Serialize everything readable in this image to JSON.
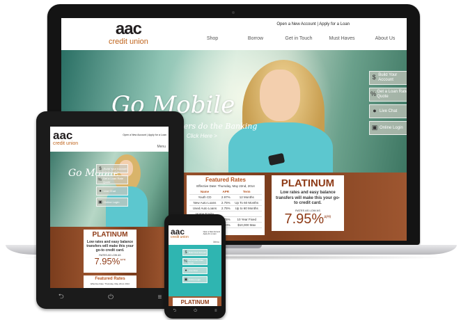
{
  "brand": {
    "name": "aac",
    "tagline": "credit union"
  },
  "top_links": {
    "open_account": "Open a New Account",
    "separator": "|",
    "apply_loan": "Apply for a Loan"
  },
  "nav": [
    "Shop",
    "Borrow",
    "Get in Touch",
    "Must Haves",
    "About Us"
  ],
  "menu_label": "Menu",
  "hero": {
    "title": "Go Mobile",
    "subtitle": "Let Your Fingers do the Banking",
    "cta": "Click Here >"
  },
  "side_buttons": [
    {
      "label": "Build Your Account",
      "icon": "dollar-icon"
    },
    {
      "label": "Get a Loan Rate Quote",
      "icon": "percent-icon"
    },
    {
      "label": "Live Chat",
      "icon": "chat-icon"
    },
    {
      "label": "Online Login",
      "icon": "lock-icon"
    }
  ],
  "rates": {
    "title": "Featured Rates",
    "effective": "Effective Date: Thursday, May 22nd, 2014",
    "headers": [
      "Name",
      "APR",
      "Term"
    ],
    "rows": [
      [
        "Youth CD",
        "2.97%",
        "12 Months"
      ],
      [
        "New Auto Loans",
        "2.75%",
        "Up To 60 Months"
      ],
      [
        "Used Auto Loans",
        "2.75%",
        "Up to 60 Months"
      ],
      [
        "Home Equity",
        "",
        ""
      ],
      [
        "",
        "4.75%",
        "10 Year Fixed"
      ],
      [
        "",
        "4.00%",
        "$10,000 Max"
      ]
    ]
  },
  "platinum": {
    "title": "PLATINUM",
    "desc": "Low rates and easy balance transfers will make this your go-to credit card.",
    "rates_as_low_as": "RATES AS LOW AS",
    "rate": "7.95%",
    "apr": "APR"
  },
  "tablet_rates": {
    "title": "Featured Rates",
    "effective": "Effective Date: Thursday, May 22nd, 2014"
  },
  "device_keys": {
    "back": "⮌",
    "home": "⏻",
    "menu": "≡"
  }
}
